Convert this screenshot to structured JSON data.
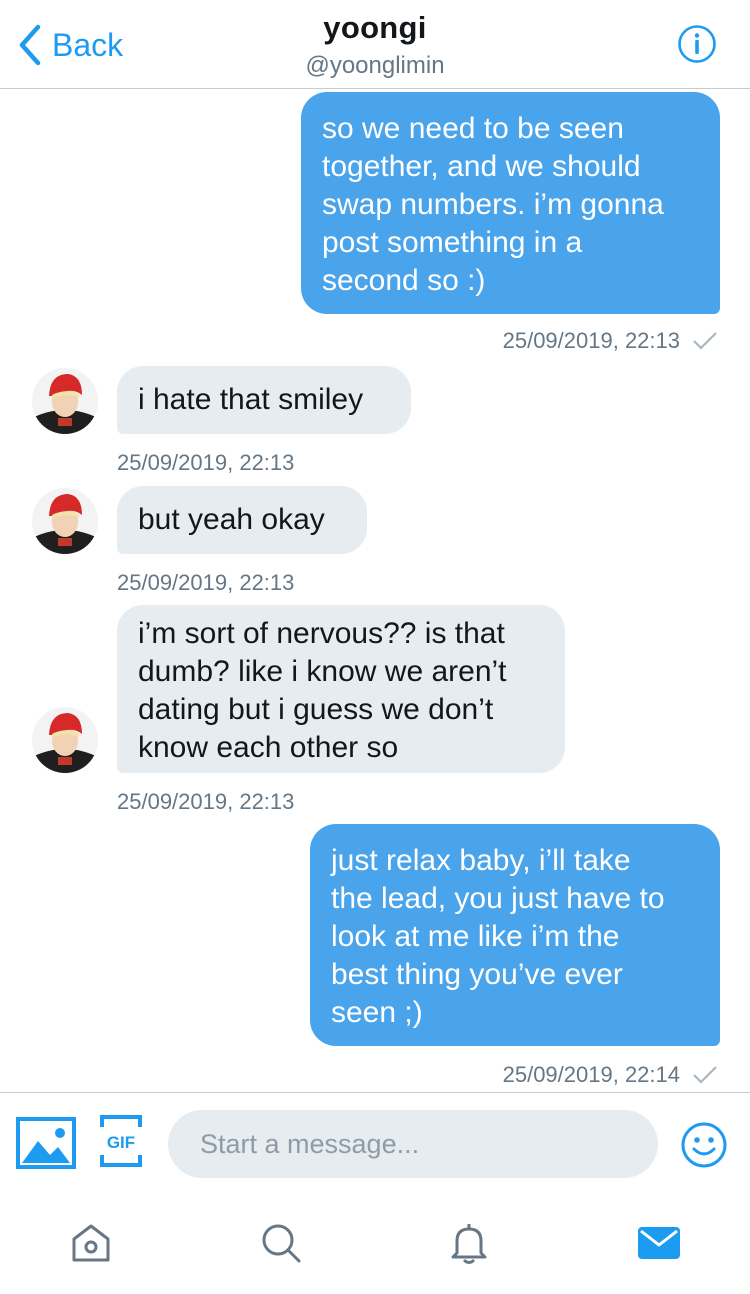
{
  "header": {
    "back_label": "Back",
    "title": "yoongi",
    "handle": "@yoonglimin"
  },
  "messages": [
    {
      "direction": "outgoing",
      "text": "so we need to be seen\ntogether, and we should\nswap numbers. i’m gonna\npost something in a\nsecond so :)",
      "timestamp": "25/09/2019, 22:13"
    },
    {
      "direction": "incoming",
      "text": "i hate that smiley",
      "timestamp": "25/09/2019, 22:13"
    },
    {
      "direction": "incoming",
      "text": "but yeah okay",
      "timestamp": "25/09/2019, 22:13"
    },
    {
      "direction": "incoming",
      "text": "i’m sort of nervous?? is that\ndumb? like i know we aren’t\ndating but i guess we don’t\nknow each other so",
      "timestamp": "25/09/2019, 22:13"
    },
    {
      "direction": "outgoing",
      "text": "just relax baby, i’ll take\nthe lead, you just have to\nlook at me like i’m the\nbest thing you’ve ever\nseen ;)",
      "timestamp": "25/09/2019, 22:14"
    }
  ],
  "composer": {
    "placeholder": "Start a message...",
    "gif_label": "GIF"
  },
  "icons": {
    "back": "chevron-left-icon",
    "info": "info-icon",
    "media": "image-icon",
    "gif": "gif-icon",
    "emoji": "emoji-icon",
    "home": "home-icon",
    "search": "search-icon",
    "notifications": "bell-icon",
    "messages": "mail-icon"
  },
  "colors": {
    "accent": "#1d9bf0",
    "outgoing_bubble": "#4aa4ec",
    "incoming_bubble": "#e6ecf0",
    "secondary_text": "#657786"
  }
}
